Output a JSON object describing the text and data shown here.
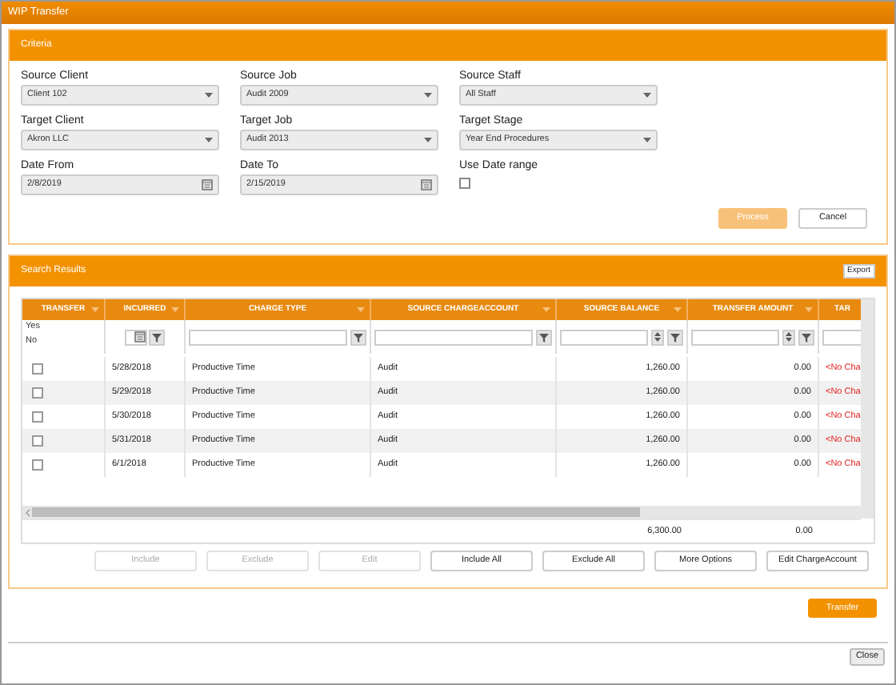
{
  "window": {
    "title": "WIP Transfer"
  },
  "criteria": {
    "title": "Criteria",
    "fields": [
      {
        "kind": "select",
        "label": "Source Client",
        "value": "Client 102"
      },
      {
        "kind": "select",
        "label": "Source Job",
        "value": "Audit 2009"
      },
      {
        "kind": "select",
        "label": "Source Staff",
        "value": "All Staff"
      },
      {
        "kind": "select",
        "label": "Target Client",
        "value": "Akron LLC"
      },
      {
        "kind": "select",
        "label": "Target Job",
        "value": "Audit 2013"
      },
      {
        "kind": "select",
        "label": "Target Stage",
        "value": "Year End Procedures"
      },
      {
        "kind": "date",
        "label": "Date From",
        "value": "2/8/2019"
      },
      {
        "kind": "date",
        "label": "Date To",
        "value": "2/15/2019"
      },
      {
        "kind": "checkbox",
        "label": "Use Date range",
        "checked": false
      }
    ],
    "buttons": [
      {
        "label": "Process",
        "primary": true,
        "disabled": true
      },
      {
        "label": "Cancel",
        "primary": false,
        "disabled": false
      }
    ]
  },
  "results": {
    "title": "Search Results",
    "export": "Export",
    "columns": [
      {
        "label": "TRANSFER",
        "menu": true,
        "kind": "yesno"
      },
      {
        "label": "INCURRED",
        "menu": true,
        "kind": "date"
      },
      {
        "label": "CHARGE TYPE",
        "menu": true,
        "kind": "text"
      },
      {
        "label": "SOURCE CHARGEACCOUNT",
        "menu": true,
        "kind": "text"
      },
      {
        "label": "SOURCE BALANCE",
        "menu": true,
        "kind": "number"
      },
      {
        "label": "TRANSFER AMOUNT",
        "menu": true,
        "kind": "number"
      },
      {
        "label": "TAR",
        "menu": false,
        "kind": "blank"
      }
    ],
    "filter_options": [
      "Yes",
      "No"
    ],
    "rows": [
      {
        "checked": false,
        "incurred": "5/28/2018",
        "charge_type": "Productive Time",
        "account": "Audit",
        "balance": "1,260.00",
        "amount": "0.00",
        "target": "<No Cha"
      },
      {
        "checked": false,
        "incurred": "5/29/2018",
        "charge_type": "Productive Time",
        "account": "Audit",
        "balance": "1,260.00",
        "amount": "0.00",
        "target": "<No Cha"
      },
      {
        "checked": false,
        "incurred": "5/30/2018",
        "charge_type": "Productive Time",
        "account": "Audit",
        "balance": "1,260.00",
        "amount": "0.00",
        "target": "<No Cha"
      },
      {
        "checked": false,
        "incurred": "5/31/2018",
        "charge_type": "Productive Time",
        "account": "Audit",
        "balance": "1,260.00",
        "amount": "0.00",
        "target": "<No Cha"
      },
      {
        "checked": false,
        "incurred": "6/1/2018",
        "charge_type": "Productive Time",
        "account": "Audit",
        "balance": "1,260.00",
        "amount": "0.00",
        "target": "<No Cha"
      }
    ],
    "totals": {
      "balance": "6,300.00",
      "amount": "0.00"
    },
    "buttons": [
      {
        "label": "Include",
        "disabled": true
      },
      {
        "label": "Exclude",
        "disabled": true
      },
      {
        "label": "Edit",
        "disabled": true
      },
      {
        "label": "Include All",
        "disabled": false
      },
      {
        "label": "Exclude All",
        "disabled": false
      },
      {
        "label": "More Options",
        "disabled": false
      },
      {
        "label": "Edit ChargeAccount",
        "disabled": false
      }
    ]
  },
  "transfer_button": "Transfer",
  "close_button": "Close"
}
